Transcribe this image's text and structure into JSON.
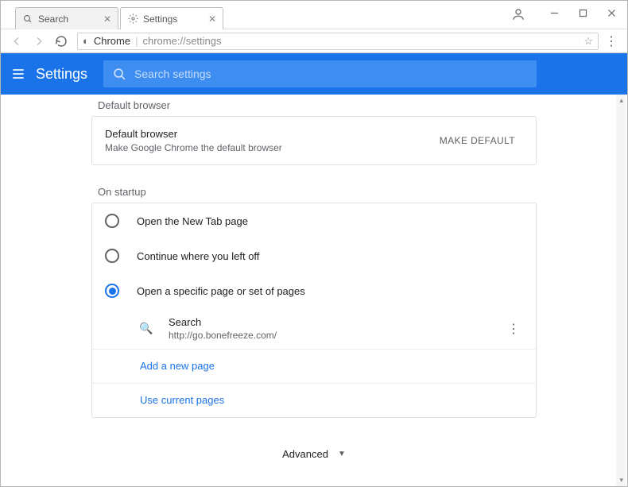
{
  "tabs": [
    {
      "label": "Search",
      "icon": "search"
    },
    {
      "label": "Settings",
      "icon": "gear"
    }
  ],
  "omnibox": {
    "scheme_label": "Chrome",
    "origin": "chrome://",
    "path": "settings"
  },
  "header": {
    "title": "Settings",
    "search_placeholder": "Search settings"
  },
  "sections": {
    "default_browser": {
      "heading": "Default browser",
      "title": "Default browser",
      "subtitle": "Make Google Chrome the default browser",
      "button": "MAKE DEFAULT"
    },
    "on_startup": {
      "heading": "On startup",
      "options": [
        "Open the New Tab page",
        "Continue where you left off",
        "Open a specific page or set of pages"
      ],
      "selected_index": 2,
      "pages": [
        {
          "name": "Search",
          "url": "http://go.bonefreeze.com/"
        }
      ],
      "add_page": "Add a new page",
      "use_current": "Use current pages"
    }
  },
  "advanced_label": "Advanced"
}
